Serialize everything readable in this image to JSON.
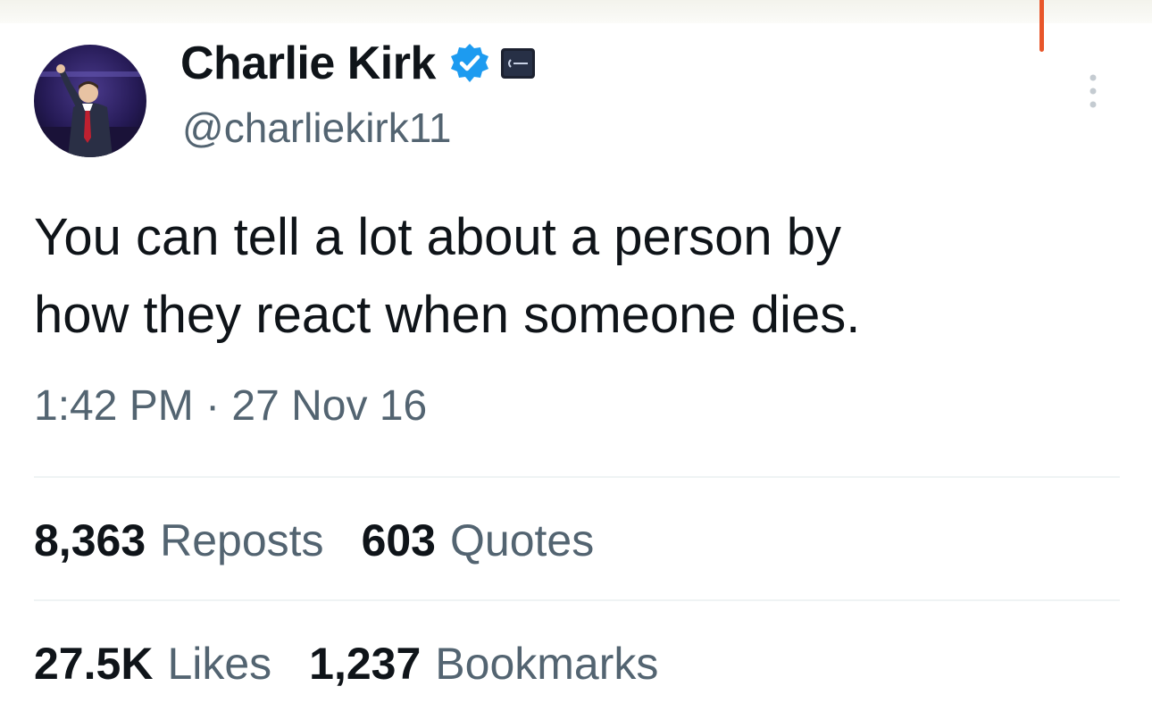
{
  "tweet": {
    "display_name": "Charlie Kirk",
    "handle": "@charliekirk11",
    "text_line1": "You can tell a lot about a person by",
    "text_line2": "how they react when someone dies.",
    "timestamp": "1:42 PM · 27 Nov 16",
    "verified": true
  },
  "stats": {
    "reposts": {
      "count": "8,363",
      "label": "Reposts"
    },
    "quotes": {
      "count": "603",
      "label": "Quotes"
    },
    "likes": {
      "count": "27.5K",
      "label": "Likes"
    },
    "bookmarks": {
      "count": "1,237",
      "label": "Bookmarks"
    }
  },
  "icons": {
    "verified": "verified-badge-icon",
    "affiliation": "organization-badge-icon",
    "more": "more-options-icon"
  },
  "colors": {
    "verified_blue": "#1d9bf0",
    "text_primary": "#0f1419",
    "text_secondary": "#536471",
    "divider": "#eff3f4"
  }
}
